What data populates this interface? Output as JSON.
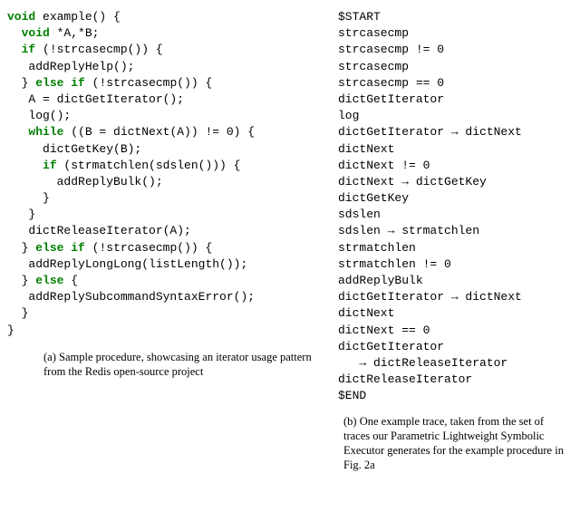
{
  "code": {
    "kw_void1": "void",
    "func_sig": " example() {",
    "kw_void2": "void",
    "decl": " *A,*B;",
    "kw_if1": "if",
    "cond1": " (!strcasecmp()) {",
    "call1": "addReplyHelp();",
    "kw_else1": "else",
    "kw_if2": "if",
    "cond2": " (!strcasecmp()) {",
    "assign1": "A = dictGetIterator();",
    "call2": "log();",
    "kw_while": "while",
    "cond3": " ((B = dictNext(A)) != 0) {",
    "call3": "dictGetKey(B);",
    "kw_if3": "if",
    "cond4": " (strmatchlen(sdslen())) {",
    "call4": "addReplyBulk();",
    "close1": "}",
    "close2": "}",
    "call5": "dictReleaseIterator(A);",
    "kw_else2": "else",
    "kw_if4": "if",
    "cond5": " (!strcasecmp()) {",
    "call6": "addReplyLongLong(listLength());",
    "kw_else3": "else",
    "open_else": " {",
    "call7": "addReplySubcommandSyntaxError();",
    "close3": "}",
    "close4": "}"
  },
  "trace": {
    "t0": "$START",
    "t1": "strcasecmp",
    "t2": "strcasecmp != 0",
    "t3": "strcasecmp",
    "t4": "strcasecmp == 0",
    "t5": "dictGetIterator",
    "t6": "log",
    "t7": "dictGetIterator → dictNext",
    "t8": "dictNext",
    "t9": "dictNext != 0",
    "t10": "dictNext → dictGetKey",
    "t11": "dictGetKey",
    "t12": "sdslen",
    "t13": "sdslen → strmatchlen",
    "t14": "strmatchlen",
    "t15": "strmatchlen != 0",
    "t16": "addReplyBulk",
    "t17": "dictGetIterator → dictNext",
    "t18": "dictNext",
    "t19": "dictNext == 0",
    "t20": "dictGetIterator",
    "t21": "   → dictReleaseIterator",
    "t22": "dictReleaseIterator",
    "t23": "$END"
  },
  "captions": {
    "left": "(a) Sample procedure, showcasing an iterator usage pattern from the Redis open-source project",
    "right": "(b) One example trace, taken from the set of traces our Parametric Lightweight Symbolic Executor generates for the example procedure in Fig. 2a"
  }
}
